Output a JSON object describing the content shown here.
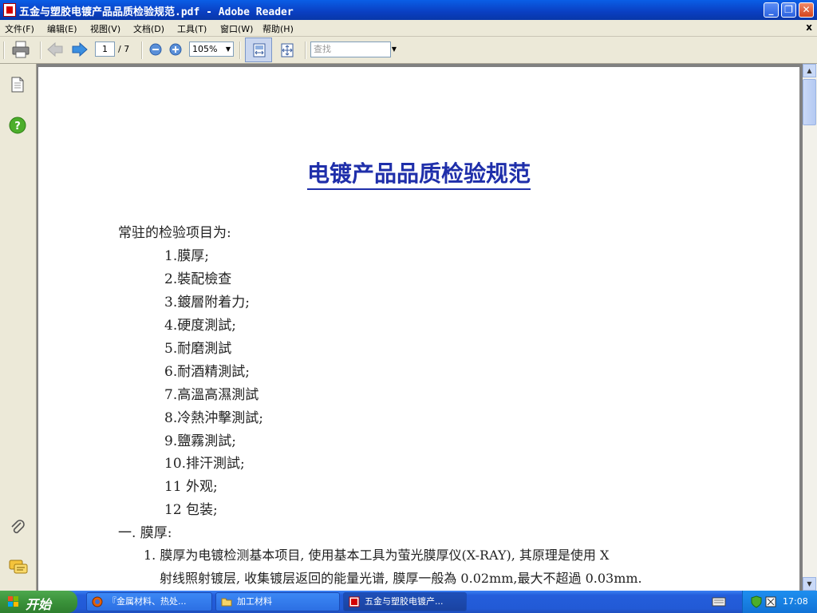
{
  "window": {
    "title": "五金与塑胶电镀产品品质检验规范.pdf - Adobe Reader"
  },
  "menu": {
    "items": [
      "文件(F)",
      "编辑(E)",
      "视图(V)",
      "文档(D)",
      "工具(T)",
      "窗口(W)",
      "帮助(H)"
    ],
    "close_glyph": "x"
  },
  "toolbar": {
    "current_page": "1",
    "total_pages": "/ 7",
    "zoom": "105%",
    "find_placeholder": "查找"
  },
  "document": {
    "title": "电镀产品品质检验规范",
    "intro": "常驻的检验项目为:",
    "items": [
      "1.膜厚;",
      "2.裝配檢查",
      "3.鍍層附着力;",
      "4.硬度測試;",
      "5.耐磨測試",
      "6.耐酒精測試;",
      "7.高溫高濕測試",
      "8.冷熱沖擊測試;",
      "9.鹽霧測試;",
      "10.排汗測試;",
      "11 外观;",
      "12 包装;"
    ],
    "section1": "一. 膜厚:",
    "para_line1": "1. 膜厚为电镀检测基本项目, 使用基本工具为萤光膜厚仪(X-RAY), 其原理是使用 X",
    "para_line2": "射线照射镀层, 收集镀层返回的能量光谱, 膜厚一般為 0.02mm,最大不超過 0.03mm."
  },
  "taskbar": {
    "start_label": "开始",
    "tasks": [
      "『金属材料、热处...",
      "加工材料",
      "五金与塑胶电镀产..."
    ],
    "clock": "17:08"
  },
  "colors": {
    "title_blue": "#1f2faa",
    "titlebar": "#0a4fd6",
    "taskbar": "#245edb",
    "start_green": "#3a923a"
  }
}
